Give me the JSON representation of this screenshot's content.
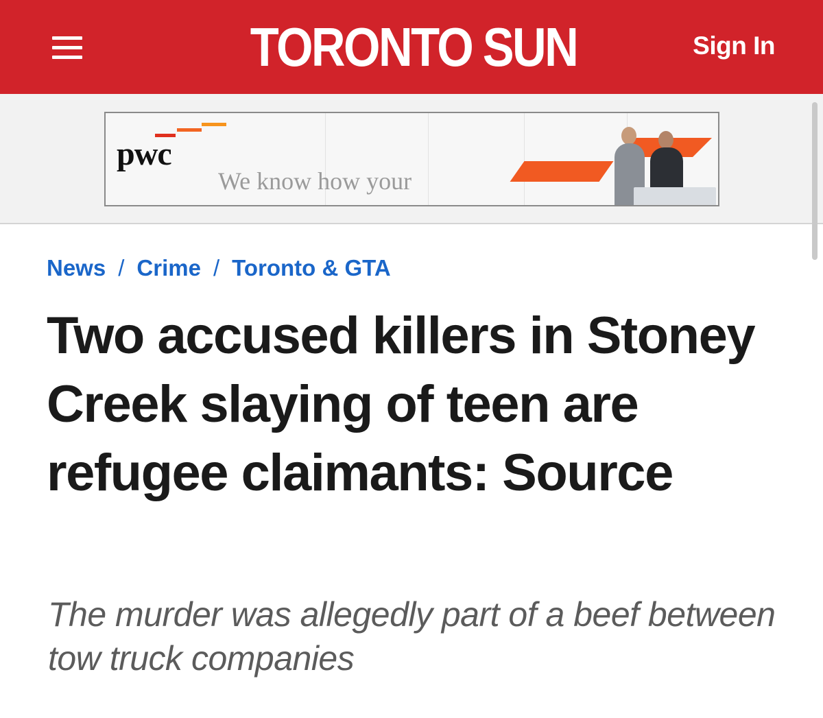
{
  "header": {
    "logo_part1": "TORONTO",
    "logo_part2": "SUN",
    "signin_label": "Sign In",
    "menu_icon": "hamburger-menu-icon",
    "brand_color": "#d1232a"
  },
  "ad": {
    "brand": "pwc",
    "tagline": "We know how your",
    "accent_color": "#f26522"
  },
  "breadcrumb": {
    "items": [
      "News",
      "Crime",
      "Toronto & GTA"
    ],
    "separator": "/",
    "link_color": "#1a66c9"
  },
  "article": {
    "headline": "Two accused killers in Stoney Creek slaying of teen are refugee claimants: Source",
    "subheadline": "The murder was allegedly part of a beef between tow truck companies"
  }
}
